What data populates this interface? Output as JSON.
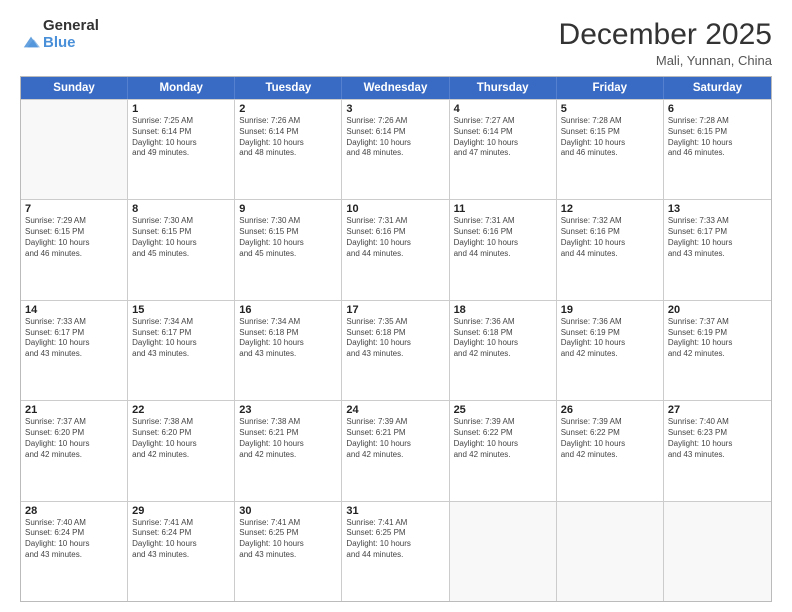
{
  "header": {
    "logo_general": "General",
    "logo_blue": "Blue",
    "month_title": "December 2025",
    "location": "Mali, Yunnan, China"
  },
  "weekdays": [
    "Sunday",
    "Monday",
    "Tuesday",
    "Wednesday",
    "Thursday",
    "Friday",
    "Saturday"
  ],
  "rows": [
    [
      {
        "day": "",
        "info": ""
      },
      {
        "day": "1",
        "info": "Sunrise: 7:25 AM\nSunset: 6:14 PM\nDaylight: 10 hours\nand 49 minutes."
      },
      {
        "day": "2",
        "info": "Sunrise: 7:26 AM\nSunset: 6:14 PM\nDaylight: 10 hours\nand 48 minutes."
      },
      {
        "day": "3",
        "info": "Sunrise: 7:26 AM\nSunset: 6:14 PM\nDaylight: 10 hours\nand 48 minutes."
      },
      {
        "day": "4",
        "info": "Sunrise: 7:27 AM\nSunset: 6:14 PM\nDaylight: 10 hours\nand 47 minutes."
      },
      {
        "day": "5",
        "info": "Sunrise: 7:28 AM\nSunset: 6:15 PM\nDaylight: 10 hours\nand 46 minutes."
      },
      {
        "day": "6",
        "info": "Sunrise: 7:28 AM\nSunset: 6:15 PM\nDaylight: 10 hours\nand 46 minutes."
      }
    ],
    [
      {
        "day": "7",
        "info": "Sunrise: 7:29 AM\nSunset: 6:15 PM\nDaylight: 10 hours\nand 46 minutes."
      },
      {
        "day": "8",
        "info": "Sunrise: 7:30 AM\nSunset: 6:15 PM\nDaylight: 10 hours\nand 45 minutes."
      },
      {
        "day": "9",
        "info": "Sunrise: 7:30 AM\nSunset: 6:15 PM\nDaylight: 10 hours\nand 45 minutes."
      },
      {
        "day": "10",
        "info": "Sunrise: 7:31 AM\nSunset: 6:16 PM\nDaylight: 10 hours\nand 44 minutes."
      },
      {
        "day": "11",
        "info": "Sunrise: 7:31 AM\nSunset: 6:16 PM\nDaylight: 10 hours\nand 44 minutes."
      },
      {
        "day": "12",
        "info": "Sunrise: 7:32 AM\nSunset: 6:16 PM\nDaylight: 10 hours\nand 44 minutes."
      },
      {
        "day": "13",
        "info": "Sunrise: 7:33 AM\nSunset: 6:17 PM\nDaylight: 10 hours\nand 43 minutes."
      }
    ],
    [
      {
        "day": "14",
        "info": "Sunrise: 7:33 AM\nSunset: 6:17 PM\nDaylight: 10 hours\nand 43 minutes."
      },
      {
        "day": "15",
        "info": "Sunrise: 7:34 AM\nSunset: 6:17 PM\nDaylight: 10 hours\nand 43 minutes."
      },
      {
        "day": "16",
        "info": "Sunrise: 7:34 AM\nSunset: 6:18 PM\nDaylight: 10 hours\nand 43 minutes."
      },
      {
        "day": "17",
        "info": "Sunrise: 7:35 AM\nSunset: 6:18 PM\nDaylight: 10 hours\nand 43 minutes."
      },
      {
        "day": "18",
        "info": "Sunrise: 7:36 AM\nSunset: 6:18 PM\nDaylight: 10 hours\nand 42 minutes."
      },
      {
        "day": "19",
        "info": "Sunrise: 7:36 AM\nSunset: 6:19 PM\nDaylight: 10 hours\nand 42 minutes."
      },
      {
        "day": "20",
        "info": "Sunrise: 7:37 AM\nSunset: 6:19 PM\nDaylight: 10 hours\nand 42 minutes."
      }
    ],
    [
      {
        "day": "21",
        "info": "Sunrise: 7:37 AM\nSunset: 6:20 PM\nDaylight: 10 hours\nand 42 minutes."
      },
      {
        "day": "22",
        "info": "Sunrise: 7:38 AM\nSunset: 6:20 PM\nDaylight: 10 hours\nand 42 minutes."
      },
      {
        "day": "23",
        "info": "Sunrise: 7:38 AM\nSunset: 6:21 PM\nDaylight: 10 hours\nand 42 minutes."
      },
      {
        "day": "24",
        "info": "Sunrise: 7:39 AM\nSunset: 6:21 PM\nDaylight: 10 hours\nand 42 minutes."
      },
      {
        "day": "25",
        "info": "Sunrise: 7:39 AM\nSunset: 6:22 PM\nDaylight: 10 hours\nand 42 minutes."
      },
      {
        "day": "26",
        "info": "Sunrise: 7:39 AM\nSunset: 6:22 PM\nDaylight: 10 hours\nand 42 minutes."
      },
      {
        "day": "27",
        "info": "Sunrise: 7:40 AM\nSunset: 6:23 PM\nDaylight: 10 hours\nand 43 minutes."
      }
    ],
    [
      {
        "day": "28",
        "info": "Sunrise: 7:40 AM\nSunset: 6:24 PM\nDaylight: 10 hours\nand 43 minutes."
      },
      {
        "day": "29",
        "info": "Sunrise: 7:41 AM\nSunset: 6:24 PM\nDaylight: 10 hours\nand 43 minutes."
      },
      {
        "day": "30",
        "info": "Sunrise: 7:41 AM\nSunset: 6:25 PM\nDaylight: 10 hours\nand 43 minutes."
      },
      {
        "day": "31",
        "info": "Sunrise: 7:41 AM\nSunset: 6:25 PM\nDaylight: 10 hours\nand 44 minutes."
      },
      {
        "day": "",
        "info": ""
      },
      {
        "day": "",
        "info": ""
      },
      {
        "day": "",
        "info": ""
      }
    ]
  ]
}
